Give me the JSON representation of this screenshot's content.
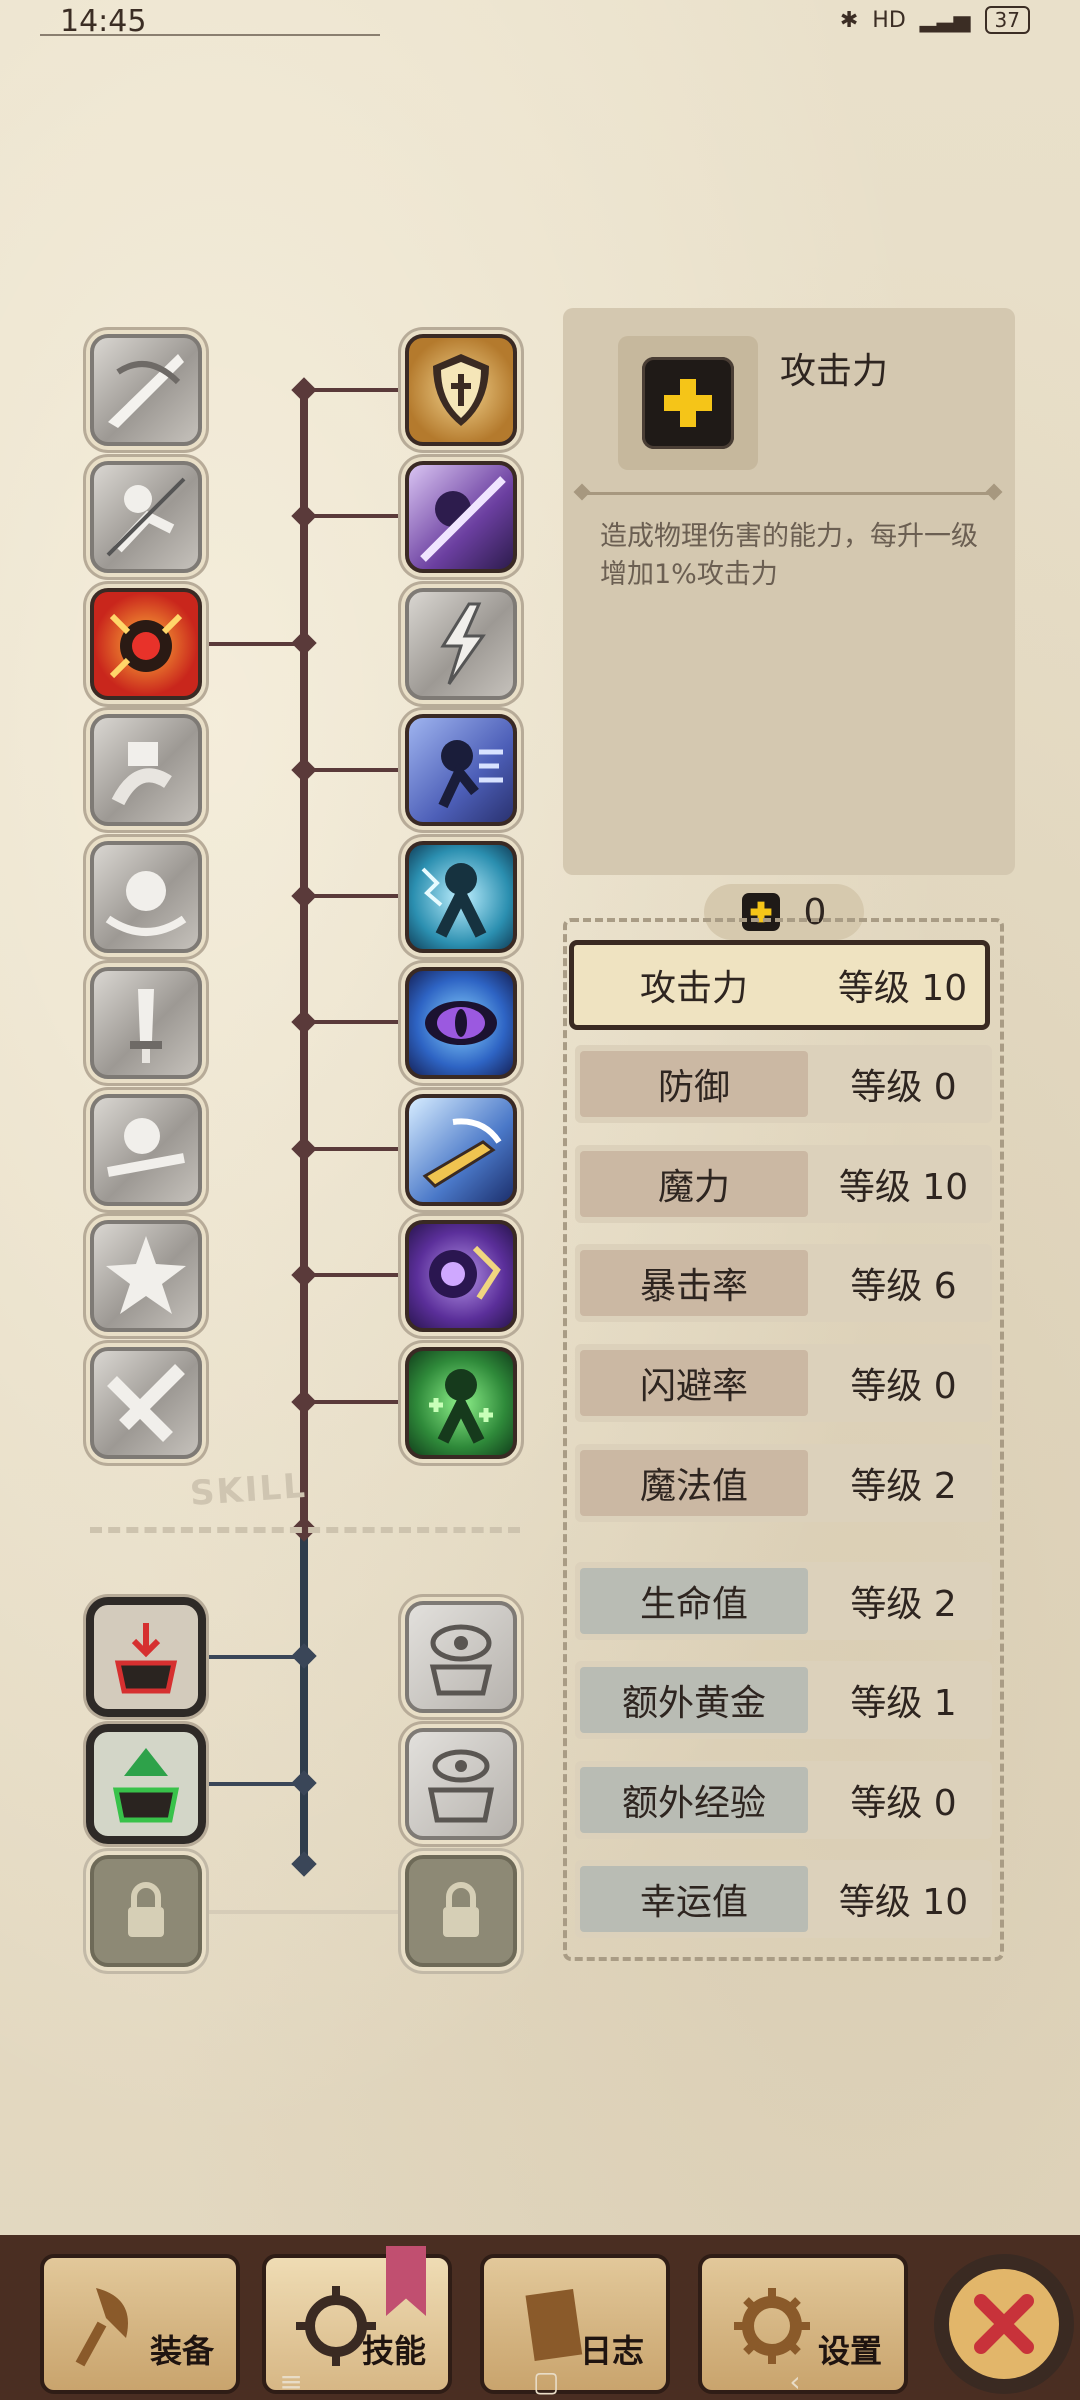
{
  "status": {
    "time": "14:45",
    "hd": "HD",
    "battery": "37"
  },
  "tree": {
    "skill_tag": "SKILL"
  },
  "info": {
    "title": "攻击力",
    "description": "造成物理伤害的能力，每升一级增加1%攻击力"
  },
  "points": {
    "value": "0"
  },
  "stats": [
    {
      "name": "攻击力",
      "level": "等级 10"
    },
    {
      "name": "防御",
      "level": "等级 0"
    },
    {
      "name": "魔力",
      "level": "等级 10"
    },
    {
      "name": "暴击率",
      "level": "等级 6"
    },
    {
      "name": "闪避率",
      "level": "等级 0"
    },
    {
      "name": "魔法值",
      "level": "等级 2"
    },
    {
      "name": "生命值",
      "level": "等级 2"
    },
    {
      "name": "额外黄金",
      "level": "等级 1"
    },
    {
      "name": "额外经验",
      "level": "等级 0"
    },
    {
      "name": "幸运值",
      "level": "等级 10"
    }
  ],
  "tabs": {
    "equipment": "装备",
    "skills": "技能",
    "log": "日志",
    "settings": "设置"
  },
  "colors": {
    "accent_yellow": "#f5c518",
    "tree_line": "#5a3a3a",
    "tree_line_blue": "#2f3d4c"
  }
}
